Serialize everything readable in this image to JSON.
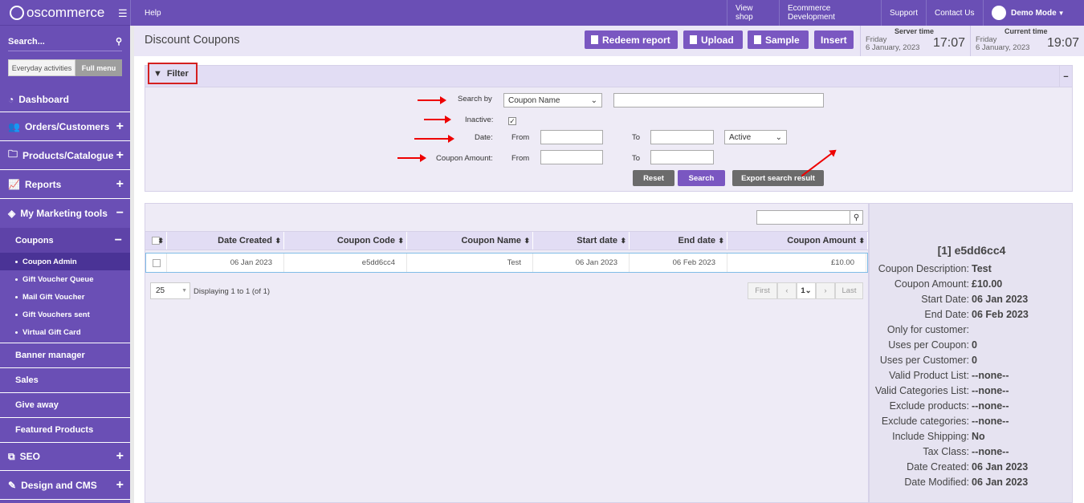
{
  "app": {
    "logo_text": "oscommerce"
  },
  "sidebar": {
    "search_label": "Search...",
    "toggle_everyday": "Everyday activities",
    "toggle_full": "Full menu",
    "items": [
      {
        "label": "Dashboard",
        "icon": "dashboard-icon",
        "pm": ""
      },
      {
        "label": "Orders/Customers",
        "icon": "users-icon",
        "pm": "+"
      },
      {
        "label": "Products/Catalogue",
        "icon": "folder-icon",
        "pm": "+"
      },
      {
        "label": "Reports",
        "icon": "chart-icon",
        "pm": "+"
      },
      {
        "label": "My Marketing tools",
        "icon": "tag-icon",
        "pm": "−"
      }
    ],
    "coupons": {
      "label": "Coupons",
      "pm": "−"
    },
    "coupon_subitems": [
      "Coupon Admin",
      "Gift Voucher Queue",
      "Mail Gift Voucher",
      "Gift Vouchers sent",
      "Virtual Gift Card"
    ],
    "more_items": [
      "Banner manager",
      "Sales",
      "Give away",
      "Featured Products"
    ],
    "bottom_items": [
      {
        "label": "SEO",
        "icon": "sitemap-icon",
        "pm": "+"
      },
      {
        "label": "Design and CMS",
        "icon": "brush-icon",
        "pm": "+"
      }
    ]
  },
  "topbar": {
    "help": "Help",
    "view_shop": "View shop",
    "ecommerce_dev": "Ecommerce Development",
    "support": "Support",
    "contact": "Contact Us",
    "user": "Demo Mode"
  },
  "header": {
    "title": "Discount Coupons",
    "buttons": {
      "redeem": "Redeem report",
      "upload": "Upload",
      "sample": "Sample",
      "insert": "Insert"
    },
    "server_time": {
      "label": "Server time",
      "day": "Friday",
      "date": "6 January, 2023",
      "time": "17:07"
    },
    "current_time": {
      "label": "Current time",
      "day": "Friday",
      "date": "6 January, 2023",
      "time": "19:07"
    }
  },
  "filter": {
    "title": "Filter",
    "collapse": "−",
    "search_by_label": "Search by",
    "search_by_value": "Coupon Name",
    "inactive_label": "Inactive:",
    "date_label": "Date:",
    "from_label": "From",
    "to_label": "To",
    "status_value": "Active",
    "amount_label": "Coupon Amount:",
    "reset": "Reset",
    "search": "Search",
    "export": "Export search result"
  },
  "table": {
    "headers": [
      "Date Created",
      "Coupon Code",
      "Coupon Name",
      "Start date",
      "End date",
      "Coupon Amount"
    ],
    "rows": [
      [
        "06 Jan 2023",
        "e5dd6cc4",
        "Test",
        "06 Jan 2023",
        "06 Feb 2023",
        "£10.00"
      ]
    ],
    "page_size": "25",
    "displaying": "Displaying 1 to 1 (of 1)",
    "pager": {
      "first": "First",
      "page": "1",
      "last": "Last"
    }
  },
  "detail": {
    "title": "[1] e5dd6cc4",
    "rows": [
      [
        "Coupon Description:",
        "Test"
      ],
      [
        "Coupon Amount:",
        "£10.00"
      ],
      [
        "Start Date:",
        "06 Jan 2023"
      ],
      [
        "End Date:",
        "06 Feb 2023"
      ],
      [
        "Only for customer:",
        ""
      ],
      [
        "Uses per Coupon:",
        "0"
      ],
      [
        "Uses per Customer:",
        "0"
      ],
      [
        "Valid Product List:",
        "--none--"
      ],
      [
        "Valid Categories List:",
        "--none--"
      ],
      [
        "Exclude products:",
        "--none--"
      ],
      [
        "Exclude categories:",
        "--none--"
      ],
      [
        "Include Shipping:",
        "No"
      ],
      [
        "Tax Class:",
        "--none--"
      ],
      [
        "Date Created:",
        "06 Jan 2023"
      ],
      [
        "Date Modified:",
        "06 Jan 2023"
      ]
    ]
  },
  "colors": {
    "brand": "#6a4fb5",
    "button": "#7a57c1",
    "annotation": "#e00000"
  }
}
